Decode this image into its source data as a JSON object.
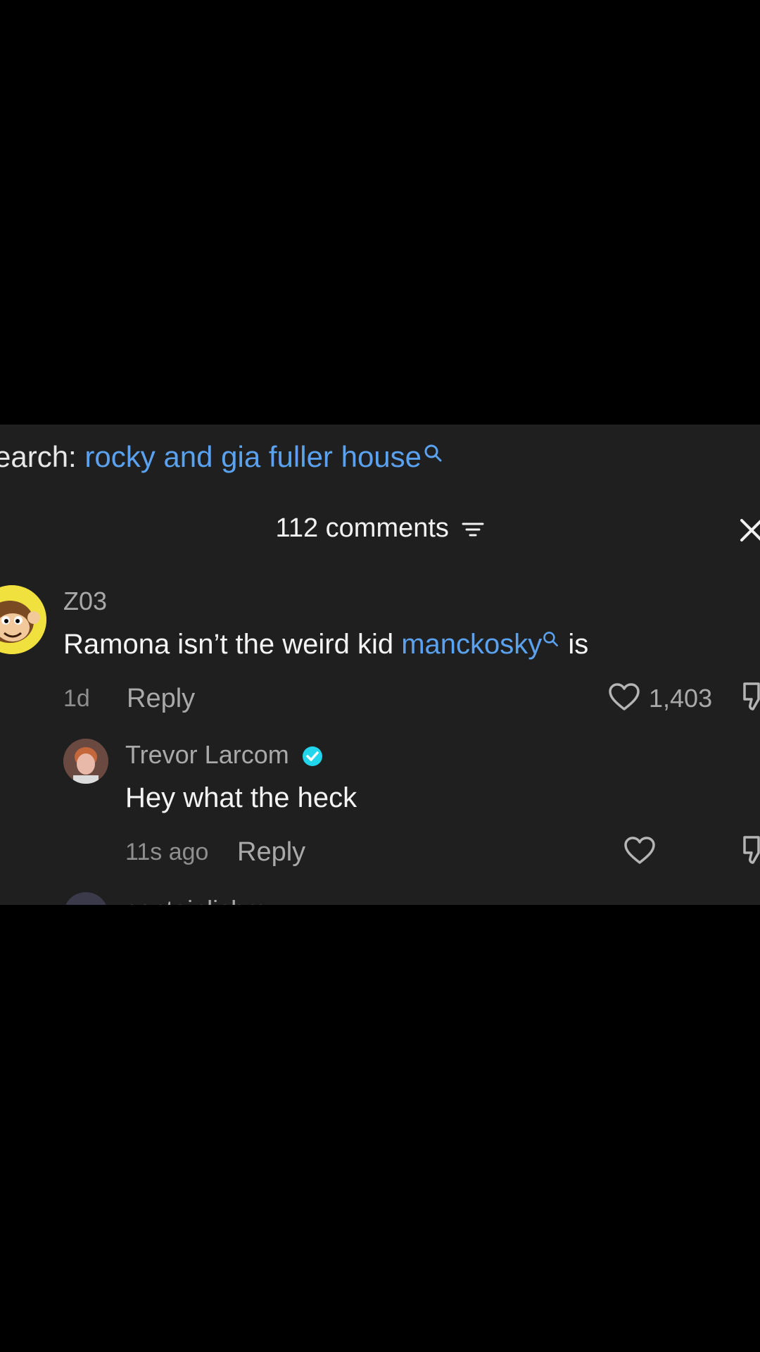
{
  "search": {
    "prefix": "earch: ",
    "query": "rocky and gia fuller house",
    "icon": "search-icon"
  },
  "header": {
    "comment_count": "112 comments",
    "filter_icon": "filter-icon",
    "close_icon": "close-icon"
  },
  "comments": [
    {
      "username": "Z03",
      "text_before": "Ramona isn’t the weird kid ",
      "mention": "manckosky",
      "text_after": " is",
      "time": "1d",
      "reply_label": "Reply",
      "likes": "1,403"
    }
  ],
  "replies": [
    {
      "username": "Trevor Larcom",
      "verified": true,
      "text": "Hey what the heck",
      "time": "11s ago",
      "reply_label": "Reply"
    }
  ],
  "next_partial": {
    "username": "captainlichm"
  },
  "colors": {
    "panel": "#1f1f1f",
    "link": "#5aa2f0",
    "verified": "#20d5ec"
  }
}
